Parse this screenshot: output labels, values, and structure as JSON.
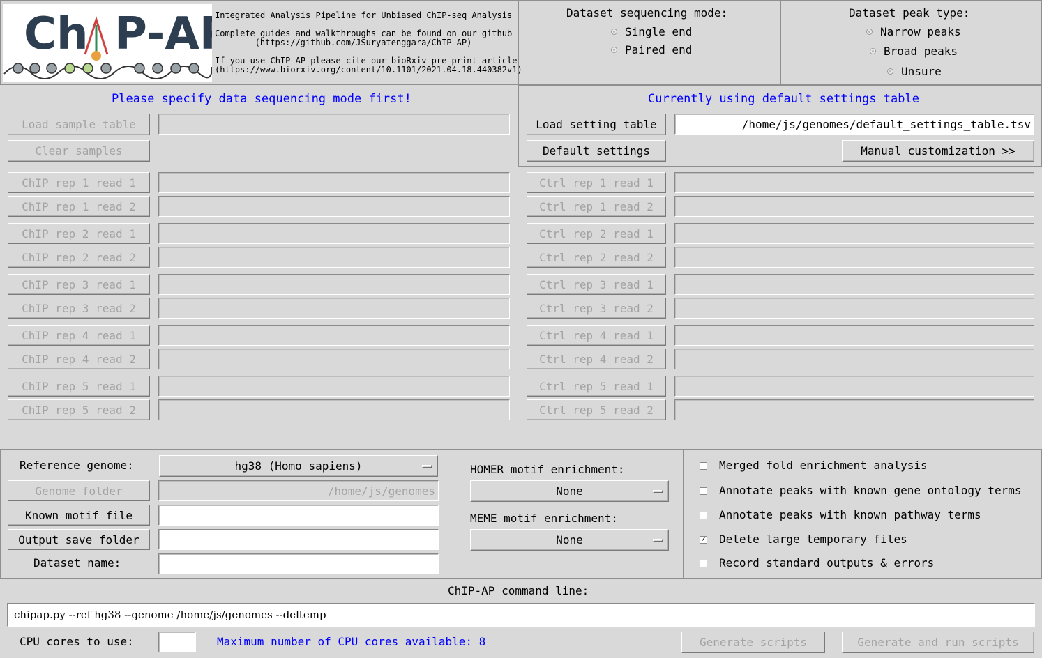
{
  "header": {
    "logo_text": "ChIP-AP",
    "line1": "Integrated Analysis Pipeline for Unbiased ChIP-seq Analysis",
    "line2a": "Complete guides and walkthroughs can be found on our github",
    "line2b": "(https://github.com/JSuryatenggara/ChIP-AP)",
    "line3a": "If you use ChIP-AP please cite our bioRxiv pre-print article",
    "line3b": "(https://www.biorxiv.org/content/10.1101/2021.04.18.440382v1)"
  },
  "seq_mode": {
    "title": "Dataset sequencing mode:",
    "options": [
      "Single end",
      "Paired end"
    ]
  },
  "peak_type": {
    "title": "Dataset peak type:",
    "options": [
      "Narrow peaks",
      "Broad peaks",
      "Unsure"
    ]
  },
  "samples": {
    "notice": "Please specify data sequencing mode first!",
    "load_label": "Load sample table",
    "clear_label": "Clear samples",
    "chip_labels": [
      "ChIP rep 1 read 1",
      "ChIP rep 1 read 2",
      "ChIP rep 2 read 1",
      "ChIP rep 2 read 2",
      "ChIP rep 3 read 1",
      "ChIP rep 3 read 2",
      "ChIP rep 4 read 1",
      "ChIP rep 4 read 2",
      "ChIP rep 5 read 1",
      "ChIP rep 5 read 2"
    ],
    "ctrl_labels": [
      "Ctrl rep 1 read 1",
      "Ctrl rep 1 read 2",
      "Ctrl rep 2 read 1",
      "Ctrl rep 2 read 2",
      "Ctrl rep 3 read 1",
      "Ctrl rep 3 read 2",
      "Ctrl rep 4 read 1",
      "Ctrl rep 4 read 2",
      "Ctrl rep 5 read 1",
      "Ctrl rep 5 read 2"
    ]
  },
  "settings": {
    "notice": "Currently using default settings table",
    "load_label": "Load setting table",
    "path": "/home/js/genomes/default_settings_table.tsv",
    "default_label": "Default settings",
    "manual_label": "Manual customization >>"
  },
  "reference": {
    "genome_label": "Reference genome:",
    "genome_value": "hg38 (Homo sapiens)",
    "folder_label": "Genome folder",
    "folder_value": "/home/js/genomes",
    "motif_label": "Known motif file",
    "output_label": "Output save folder",
    "dataset_label": "Dataset name:"
  },
  "motif": {
    "homer_label": "HOMER motif enrichment:",
    "homer_value": "None",
    "meme_label": "MEME motif enrichment:",
    "meme_value": "None"
  },
  "options": [
    {
      "label": "Merged fold enrichment analysis",
      "checked": false
    },
    {
      "label": "Annotate peaks with known gene ontology terms",
      "checked": false
    },
    {
      "label": "Annotate peaks with known pathway terms",
      "checked": false
    },
    {
      "label": "Delete large temporary files",
      "checked": true
    },
    {
      "label": "Record standard outputs & errors",
      "checked": false
    }
  ],
  "command": {
    "title": "ChIP-AP command line:",
    "text": "chipap.py --ref hg38 --genome /home/js/genomes --deltemp"
  },
  "footer": {
    "cpu_label": "CPU cores to use:",
    "cpu_value": "",
    "cpu_info": "Maximum number of CPU cores available: 8",
    "generate_label": "Generate scripts",
    "generate_run_label": "Generate and run scripts"
  }
}
